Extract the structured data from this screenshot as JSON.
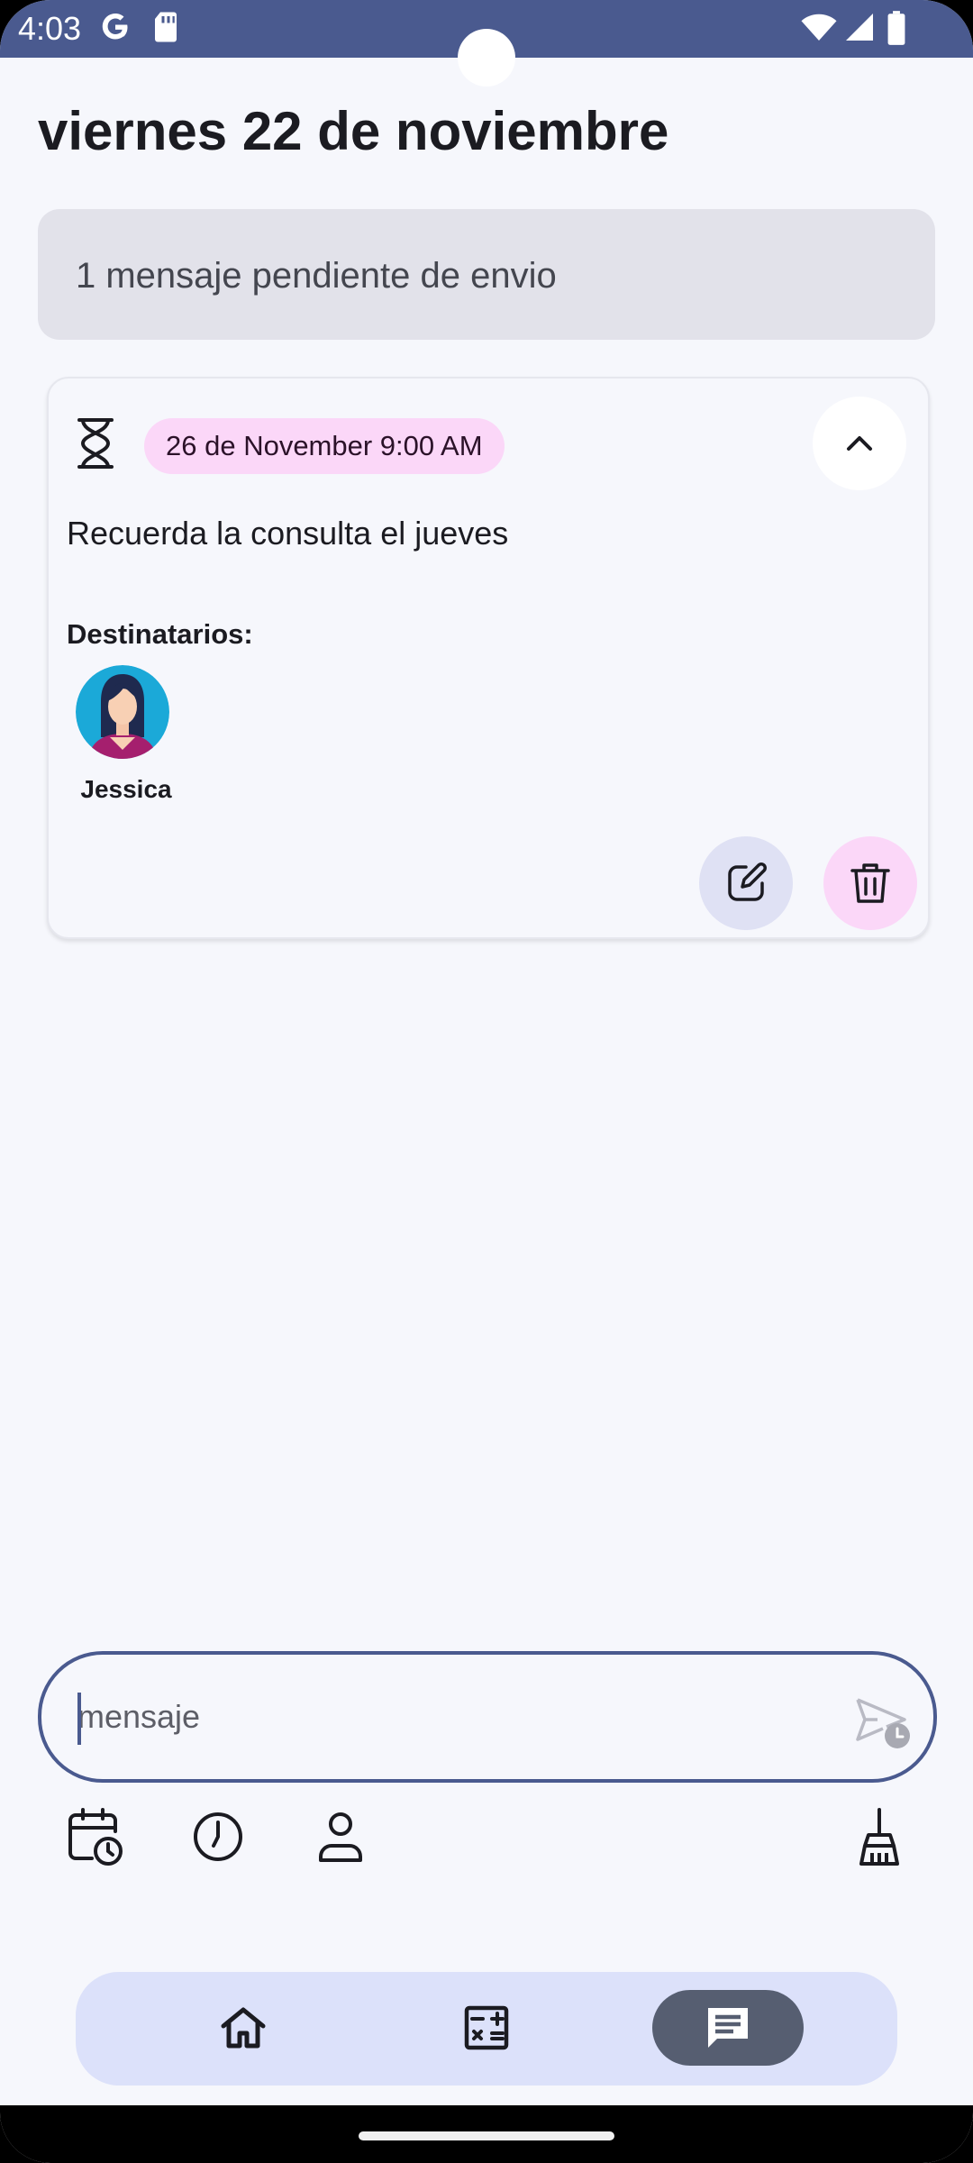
{
  "status_bar": {
    "time": "4:03",
    "icons": [
      "google-icon",
      "sd-card-icon",
      "wifi-icon",
      "signal-icon",
      "battery-icon"
    ]
  },
  "header": {
    "title": "viernes 22 de noviembre"
  },
  "pending_banner": {
    "text": "1 mensaje pendiente de envio"
  },
  "scheduled_message": {
    "status_icon": "hourglass-icon",
    "scheduled_at": "26 de November 9:00 AM",
    "body": "Recuerda la consulta el jueves",
    "recipients_label": "Destinatarios:",
    "recipients": [
      {
        "name": "Jessica",
        "avatar": "female-avatar"
      }
    ],
    "actions": [
      "edit-icon",
      "delete-icon"
    ]
  },
  "composer": {
    "placeholder": "mensaje",
    "value": "",
    "send_icon": "schedule-send-icon",
    "tools": [
      "calendar-clock-icon",
      "clock-icon",
      "person-icon",
      "broom-icon"
    ]
  },
  "bottom_nav": {
    "items": [
      {
        "icon": "home-icon",
        "active": false
      },
      {
        "icon": "calculator-icon",
        "active": false
      },
      {
        "icon": "message-icon",
        "active": true
      }
    ]
  },
  "colors": {
    "primary": "#4a5a8f",
    "background": "#f6f7fc",
    "banner": "#e2e2ea",
    "chip_pink": "#fbd7f8",
    "chip_blue": "#dfe1f4",
    "nav_background": "#dce1fa",
    "nav_active": "#565e71"
  }
}
